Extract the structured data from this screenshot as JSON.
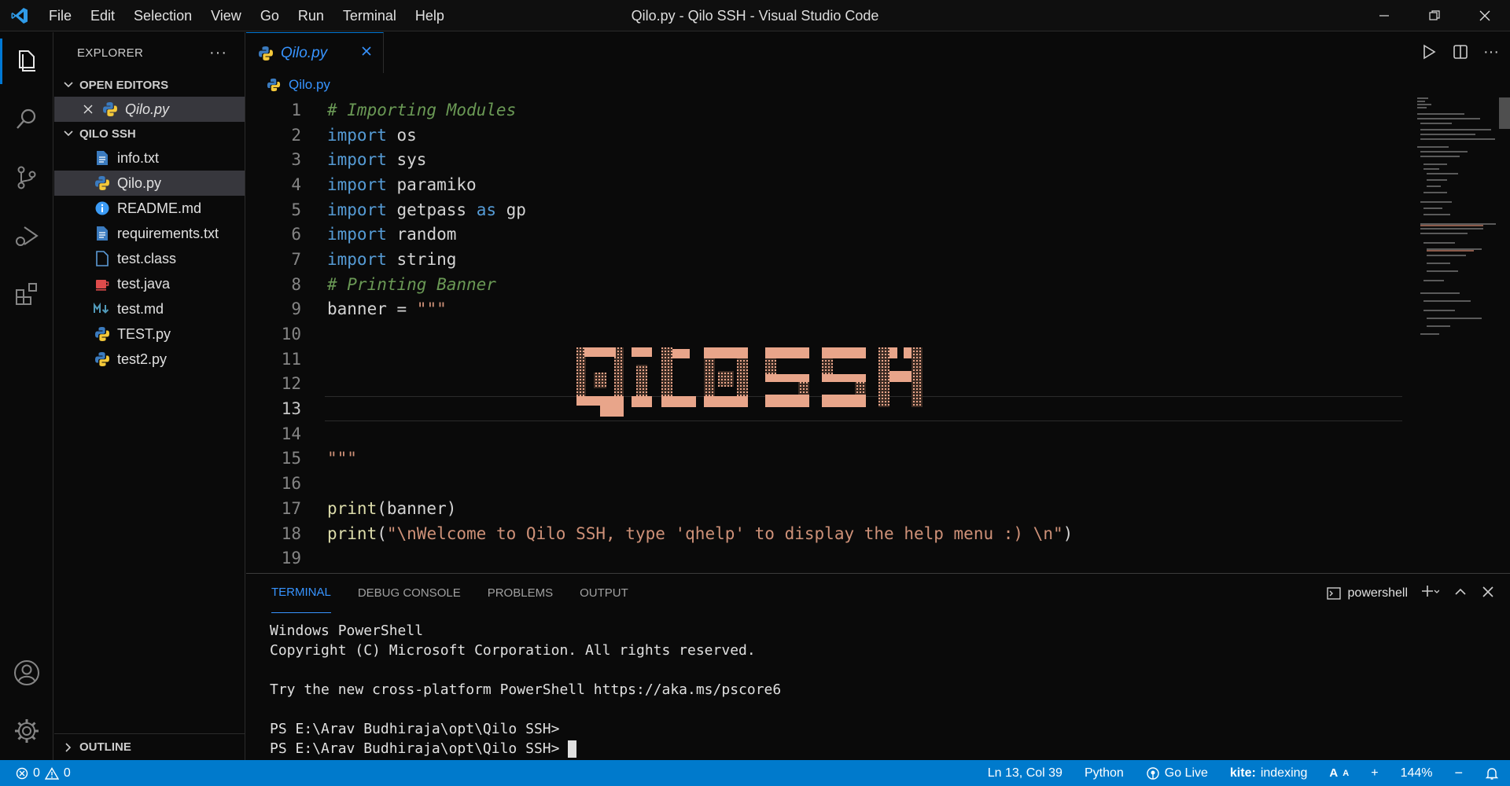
{
  "window": {
    "title": "Qilo.py - Qilo SSH - Visual Studio Code",
    "menu": [
      "File",
      "Edit",
      "Selection",
      "View",
      "Go",
      "Run",
      "Terminal",
      "Help"
    ]
  },
  "activity_bar": {
    "icons": [
      "explorer-icon",
      "search-icon",
      "source-control-icon",
      "run-debug-icon",
      "extensions-icon"
    ],
    "bottom_icons": [
      "account-icon",
      "settings-gear-icon"
    ]
  },
  "sidebar": {
    "title": "EXPLORER",
    "open_editors_label": "OPEN EDITORS",
    "open_editors": [
      {
        "name": "Qilo.py"
      }
    ],
    "folder_label": "QILO SSH",
    "files": [
      {
        "name": "info.txt",
        "icon": "text-file-icon"
      },
      {
        "name": "Qilo.py",
        "icon": "python-icon"
      },
      {
        "name": "README.md",
        "icon": "info-icon"
      },
      {
        "name": "requirements.txt",
        "icon": "text-file-icon"
      },
      {
        "name": "test.class",
        "icon": "file-icon"
      },
      {
        "name": "test.java",
        "icon": "java-icon"
      },
      {
        "name": "test.md",
        "icon": "markdown-icon"
      },
      {
        "name": "TEST.py",
        "icon": "python-icon"
      },
      {
        "name": "test2.py",
        "icon": "python-icon"
      }
    ],
    "outline_label": "OUTLINE"
  },
  "editor": {
    "tab_label": "Qilo.py",
    "breadcrumb": "Qilo.py",
    "active_line": 13,
    "lines": {
      "l1": "# Importing Modules",
      "import_kw": "import",
      "l2": "os",
      "l3": "sys",
      "l4": "paramiko",
      "l5": "getpass",
      "as_kw": "as",
      "l5b": "gp",
      "l6": "random",
      "l7": "string",
      "l8": "# Printing Banner",
      "l9a": "banner = ",
      "l9b": "\"\"\"",
      "l15": "\"\"\"",
      "print_fn": "print",
      "l17": "(banner)",
      "l18a": "(",
      "l18b": "\"\\nWelcome to Qilo SSH, type 'qhelp' to display the help menu :) \\n\"",
      "l18c": ")"
    },
    "banner_color": "#e8a58a",
    "line_numbers": [
      "1",
      "2",
      "3",
      "4",
      "5",
      "6",
      "7",
      "8",
      "9",
      "10",
      "11",
      "12",
      "13",
      "14",
      "15",
      "16",
      "17",
      "18",
      "19"
    ]
  },
  "panel": {
    "tabs": [
      "TERMINAL",
      "DEBUG CONSOLE",
      "PROBLEMS",
      "OUTPUT"
    ],
    "active_tab": "TERMINAL",
    "shell": "powershell",
    "terminal_lines": [
      "Windows PowerShell",
      "Copyright (C) Microsoft Corporation. All rights reserved.",
      "",
      "Try the new cross-platform PowerShell https://aka.ms/pscore6",
      "",
      "PS E:\\Arav Budhiraja\\opt\\Qilo SSH>",
      "PS E:\\Arav Budhiraja\\opt\\Qilo SSH> "
    ]
  },
  "statusbar": {
    "errors": "0",
    "warnings": "0",
    "position": "Ln 13, Col 39",
    "language": "Python",
    "go_live": "Go Live",
    "kite_brand": "kite:",
    "kite_status": "indexing",
    "plus": "+",
    "zoom": "144%"
  },
  "colors": {
    "accent": "#007acc",
    "tab_text": "#3794ff"
  }
}
